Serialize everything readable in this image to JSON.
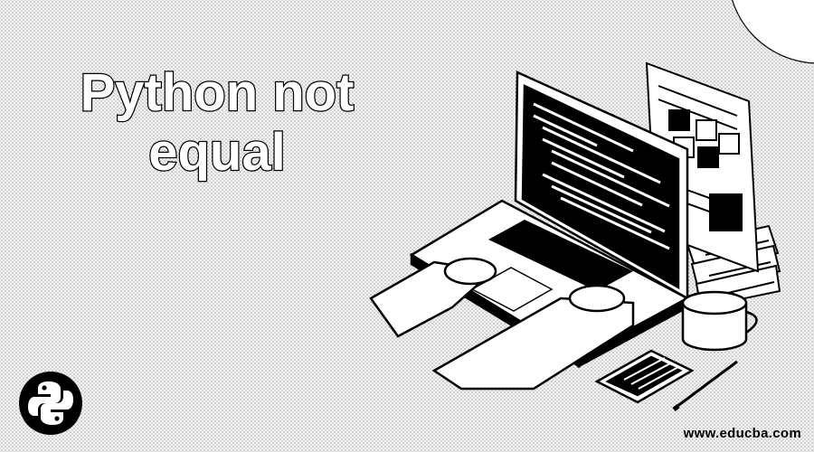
{
  "banner": {
    "title_line1": "Python not",
    "title_line2": "equal",
    "watermark": "www.educba.com"
  },
  "icons": {
    "logo": "python-logo-icon",
    "laptop": "laptop-icon",
    "hands": "typing-hands-icon",
    "mug": "coffee-mug-icon",
    "phone": "smartphone-icon",
    "pen": "pen-icon",
    "document": "document-icon",
    "books": "book-stack-icon"
  },
  "colors": {
    "ink": "#000000",
    "paper": "#ffffff"
  }
}
